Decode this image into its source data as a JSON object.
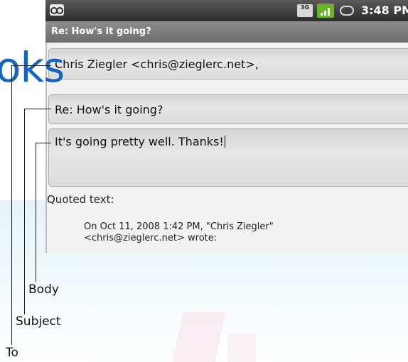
{
  "status_bar": {
    "network_badge": "3G",
    "time": "3:48 PM",
    "icons": [
      "voicemail-icon",
      "3g-icon",
      "signal-icon",
      "battery-icon"
    ]
  },
  "title_bar": {
    "title": "Re: How's it going?"
  },
  "compose": {
    "to_value": "Chris Ziegler <chris@zieglerc.net>,",
    "subject_value": "Re: How's it going?",
    "body_value": "It's going pretty well. Thanks!",
    "quoted_label": "Quoted text:",
    "quoted_lines": [
      "On Oct 11, 2008 1:42 PM, \"Chris Ziegler\"",
      "<chris@zieglerc.net> wrote:"
    ]
  },
  "watermark": "oks",
  "callouts": {
    "to": "To",
    "subject": "Subject",
    "body": "Body"
  },
  "colors": {
    "status_bar": "#2c2c2c",
    "title_bar": "#7a7a7a",
    "field": "#dcdcdc",
    "watermark": "#1565c0",
    "signal": "#6cb32a"
  }
}
